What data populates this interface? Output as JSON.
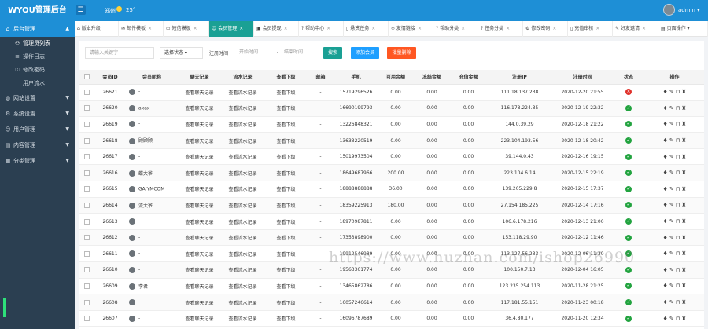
{
  "header": {
    "title": "WYOU管理后台",
    "menu_icon": "menu-icon",
    "city": "郑州",
    "temperature": "25°",
    "user": "admin"
  },
  "sidebar": {
    "items": [
      {
        "label": "后台管理",
        "active": true
      },
      {
        "label": "管理员列表",
        "sub": true,
        "active": true
      },
      {
        "label": "操作日志",
        "sub": true
      },
      {
        "label": "修改密码",
        "sub": true
      },
      {
        "label": "用户流水",
        "sub": true
      },
      {
        "label": "网站设置"
      },
      {
        "label": "系统设置"
      },
      {
        "label": "用户管理"
      },
      {
        "label": "内容管理"
      },
      {
        "label": "分类管理"
      }
    ]
  },
  "tabs": [
    {
      "label": "版本升级"
    },
    {
      "label": "邮件模板"
    },
    {
      "label": "短信模板"
    },
    {
      "label": "会员管理",
      "active": true
    },
    {
      "label": "会员提现"
    },
    {
      "label": "帮助中心"
    },
    {
      "label": "悬赏任务"
    },
    {
      "label": "友情链接"
    },
    {
      "label": "帮助分类"
    },
    {
      "label": "任务分类"
    },
    {
      "label": "修改密码"
    },
    {
      "label": "充值审核"
    },
    {
      "label": "好友邀请"
    },
    {
      "label": "页面操作"
    }
  ],
  "filter": {
    "keyword_placeholder": "请输入关键字",
    "status_select": "选择状态",
    "reg_time_label": "注册时间",
    "start_placeholder": "开始时间",
    "dash": "-",
    "end_placeholder": "结束时间",
    "search_label": "搜索",
    "add_label": "添加会员",
    "delete_label": "批量删除"
  },
  "table": {
    "headers": [
      "会员ID",
      "会员昵称",
      "聊天记录",
      "流水记录",
      "查看下级",
      "邮箱",
      "手机",
      "可用余额",
      "冻结金额",
      "充值金额",
      "注册IP",
      "注册时间",
      "状态",
      "操作"
    ],
    "rows": [
      {
        "id": "26621",
        "nick": "-",
        "chat": "查看聊天记录",
        "flow": "查看流水记录",
        "sub": "查看下级",
        "email": "-",
        "phone": "15719296526",
        "balance": "0.00",
        "frozen": "0.00",
        "recharge": "0.00",
        "ip": "111.18.137.238",
        "time": "2020-12-20 21:55",
        "status": "bad"
      },
      {
        "id": "26620",
        "nick": "axax",
        "chat": "查看聊天记录",
        "flow": "查看流水记录",
        "sub": "查看下级",
        "email": "-",
        "phone": "16690199793",
        "balance": "0.00",
        "frozen": "0.00",
        "recharge": "0.00",
        "ip": "116.178.224.35",
        "time": "2020-12-19 22:32",
        "status": "ok"
      },
      {
        "id": "26619",
        "nick": "-",
        "chat": "查看聊天记录",
        "flow": "查看流水记录",
        "sub": "查看下级",
        "email": "-",
        "phone": "13226848321",
        "balance": "0.00",
        "frozen": "0.00",
        "recharge": "0.00",
        "ip": "144.0.39.29",
        "time": "2020-12-18 21:22",
        "status": "ok"
      },
      {
        "id": "26618",
        "nick": "顾顾顾",
        "chat": "查看聊天记录",
        "flow": "查看流水记录",
        "sub": "查看下级",
        "email": "-",
        "phone": "13633220519",
        "balance": "0.00",
        "frozen": "0.00",
        "recharge": "0.00",
        "ip": "223.104.193.56",
        "time": "2020-12-18 20:42",
        "status": "ok"
      },
      {
        "id": "26617",
        "nick": "-",
        "chat": "查看聊天记录",
        "flow": "查看流水记录",
        "sub": "查看下级",
        "email": "-",
        "phone": "15019973504",
        "balance": "0.00",
        "frozen": "0.00",
        "recharge": "0.00",
        "ip": "39.144.0.43",
        "time": "2020-12-16 19:15",
        "status": "ok"
      },
      {
        "id": "26616",
        "nick": "蝶大爷",
        "chat": "查看聊天记录",
        "flow": "查看流水记录",
        "sub": "查看下级",
        "email": "-",
        "phone": "18649687966",
        "balance": "200.00",
        "frozen": "0.00",
        "recharge": "0.00",
        "ip": "223.104.6.14",
        "time": "2020-12-15 22:19",
        "status": "ok"
      },
      {
        "id": "26615",
        "nick": "GAIYMCOM",
        "chat": "查看聊天记录",
        "flow": "查看流水记录",
        "sub": "查看下级",
        "email": "-",
        "phone": "18888888888",
        "balance": "36.00",
        "frozen": "0.00",
        "recharge": "0.00",
        "ip": "139.205.229.8",
        "time": "2020-12-15 17:37",
        "status": "ok"
      },
      {
        "id": "26614",
        "nick": "流大爷",
        "chat": "查看聊天记录",
        "flow": "查看流水记录",
        "sub": "查看下级",
        "email": "-",
        "phone": "18359225913",
        "balance": "180.00",
        "frozen": "0.00",
        "recharge": "0.00",
        "ip": "27.154.185.225",
        "time": "2020-12-14 17:16",
        "status": "ok"
      },
      {
        "id": "26613",
        "nick": "-",
        "chat": "查看聊天记录",
        "flow": "查看流水记录",
        "sub": "查看下级",
        "email": "-",
        "phone": "18970987811",
        "balance": "0.00",
        "frozen": "0.00",
        "recharge": "0.00",
        "ip": "106.6.178.216",
        "time": "2020-12-13 21:00",
        "status": "ok"
      },
      {
        "id": "26612",
        "nick": "-",
        "chat": "查看聊天记录",
        "flow": "查看流水记录",
        "sub": "查看下级",
        "email": "-",
        "phone": "17353898900",
        "balance": "0.00",
        "frozen": "0.00",
        "recharge": "0.00",
        "ip": "153.118.29.90",
        "time": "2020-12-12 11:46",
        "status": "ok"
      },
      {
        "id": "26611",
        "nick": "-",
        "chat": "查看聊天记录",
        "flow": "查看流水记录",
        "sub": "查看下级",
        "email": "-",
        "phone": "19912546989",
        "balance": "0.00",
        "frozen": "0.00",
        "recharge": "0.00",
        "ip": "113.127.56.233",
        "time": "2020-12-06 11:30",
        "status": "ok"
      },
      {
        "id": "26610",
        "nick": "-",
        "chat": "查看聊天记录",
        "flow": "查看流水记录",
        "sub": "查看下级",
        "email": "-",
        "phone": "19563361774",
        "balance": "0.00",
        "frozen": "0.00",
        "recharge": "0.00",
        "ip": "100.150.7.13",
        "time": "2020-12-04 16:05",
        "status": "ok"
      },
      {
        "id": "26609",
        "nick": "李君",
        "chat": "查看聊天记录",
        "flow": "查看流水记录",
        "sub": "查看下级",
        "email": "-",
        "phone": "13465862786",
        "balance": "0.00",
        "frozen": "0.00",
        "recharge": "0.00",
        "ip": "123.235.254.113",
        "time": "2020-11-28 21:25",
        "status": "ok"
      },
      {
        "id": "26608",
        "nick": "-",
        "chat": "查看聊天记录",
        "flow": "查看流水记录",
        "sub": "查看下级",
        "email": "-",
        "phone": "16057246614",
        "balance": "0.00",
        "frozen": "0.00",
        "recharge": "0.00",
        "ip": "117.181.55.151",
        "time": "2020-11-23 00:18",
        "status": "ok"
      },
      {
        "id": "26607",
        "nick": "-",
        "chat": "查看聊天记录",
        "flow": "查看流水记录",
        "sub": "查看下级",
        "email": "-",
        "phone": "16096787689",
        "balance": "0.00",
        "frozen": "0.00",
        "recharge": "0.00",
        "ip": "36.4.80.177",
        "time": "2020-11-20 12:34",
        "status": "ok"
      }
    ]
  },
  "watermark": "https://www.huzhan.com/ishop26990",
  "colors": {
    "brand": "#1e8fd6",
    "sidebar": "#2b3f51",
    "tab_active": "#1aa094",
    "search_btn": "#1aa094",
    "add_btn": "#1e9fff",
    "delete_btn": "#ff5722",
    "ok": "#22a33f",
    "bad": "#e0322b"
  }
}
